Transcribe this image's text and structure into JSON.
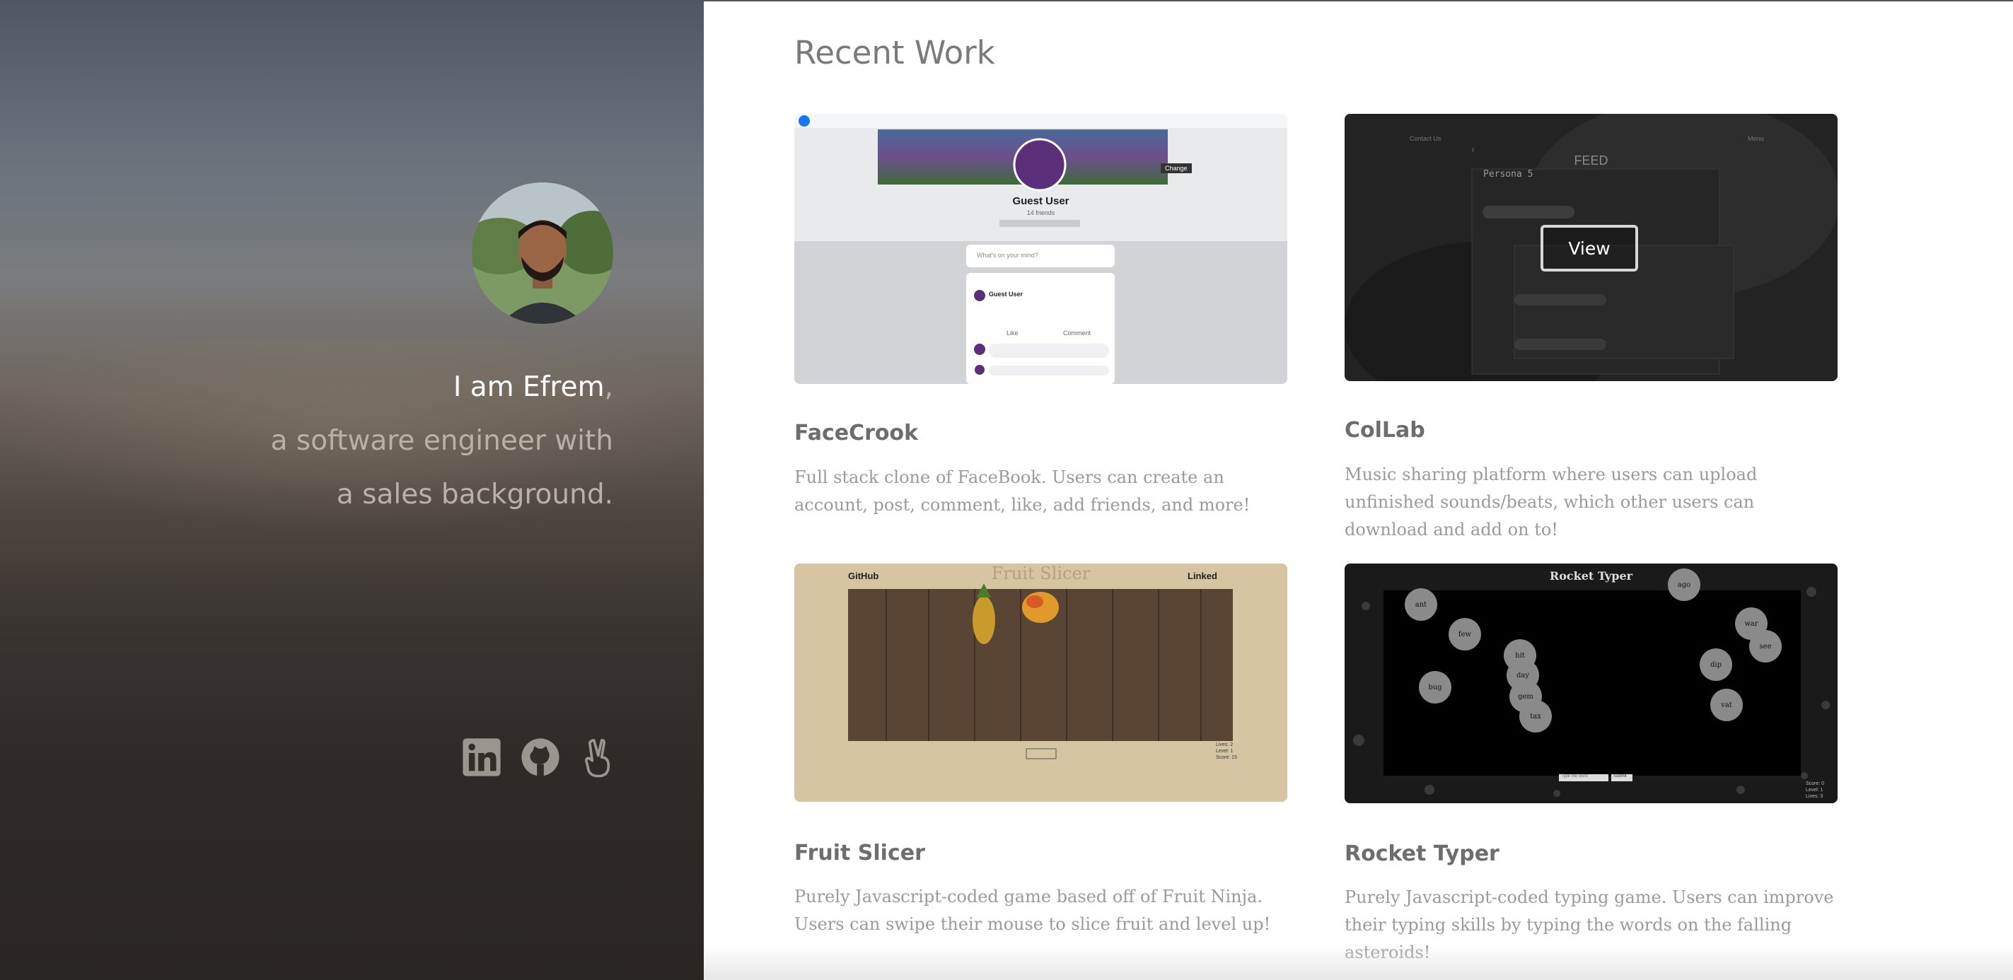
{
  "intro": {
    "line1_greeting": "I am Efrem",
    "line1_comma": ",",
    "line2": "a software engineer with",
    "line3": "a sales background."
  },
  "social": {
    "linkedin_icon": "linkedin-icon",
    "github_icon": "github-icon",
    "angellist_icon": "angellist-icon"
  },
  "section_title": "Recent Work",
  "projects": [
    {
      "title": "FaceCrook",
      "description": "Full stack clone of FaceBook. Users can create an account, post, comment, like, add friends, and more!",
      "preview": {
        "profile_name": "Guest User",
        "friends": "14 friends",
        "change_label": "Change",
        "composer_placeholder": "What's on your mind?",
        "post_author": "Guest User",
        "like_label": "Like",
        "comment_label": "Comment"
      }
    },
    {
      "title": "ColLab",
      "description": "Music sharing platform where users can upload unfinished sounds/beats, which other users can download and add on to!",
      "preview": {
        "contact_label": "Contact Us",
        "menu_label": "Menu",
        "feed_label": "FEED",
        "persona_title": "Persona 5",
        "view_label": "View"
      }
    },
    {
      "title": "Fruit Slicer",
      "description": "Purely Javascript-coded game based off of Fruit Ninja. Users can swipe their mouse to slice fruit and level up!",
      "preview": {
        "github_label": "GitHub",
        "game_title": "Fruit Slicer",
        "linkedin_label": "Linked",
        "stats": [
          "Lives: 2",
          "Level: 1",
          "Score: 15"
        ]
      }
    },
    {
      "title": "Rocket Typer",
      "description": "Purely Javascript-coded typing game. Users can improve their typing skills by typing the words on the falling asteroids!",
      "preview": {
        "game_title": "Rocket Typer",
        "words": [
          "ant",
          "few",
          "hit",
          "day",
          "gem",
          "tax",
          "bug",
          "war",
          "see",
          "dip",
          "vat",
          "ago"
        ],
        "input_placeholder": "Type the word",
        "submit_label": "Submit",
        "stats": [
          "Score: 0",
          "Level: 1",
          "Lives: 3"
        ]
      }
    }
  ],
  "colors": {
    "sidebar_top": "#4e5864",
    "sidebar_bottom": "#2a2624",
    "title_gray": "#7a7a7a",
    "text_gray": "#9a9a9a",
    "fruit_bg": "#d5c5a3",
    "dark_thumb": "#1e1e1e"
  }
}
